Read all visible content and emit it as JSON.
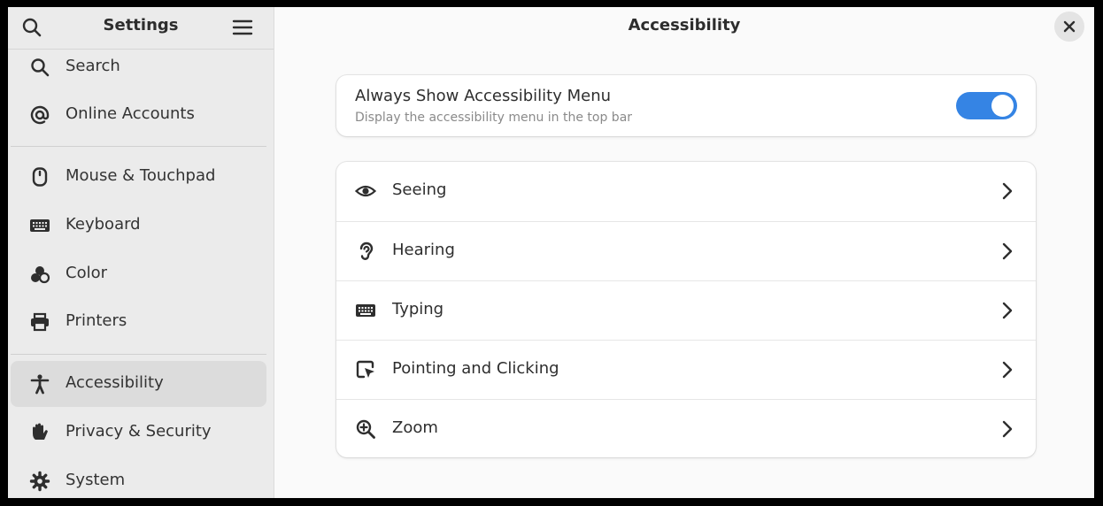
{
  "sidebar": {
    "title": "Settings",
    "items": [
      {
        "label": "Search",
        "icon": "search-icon"
      },
      {
        "label": "Online Accounts",
        "icon": "at-icon"
      },
      {
        "label": "Mouse & Touchpad",
        "icon": "mouse-icon"
      },
      {
        "label": "Keyboard",
        "icon": "keyboard-icon"
      },
      {
        "label": "Color",
        "icon": "color-icon"
      },
      {
        "label": "Printers",
        "icon": "printer-icon"
      },
      {
        "label": "Accessibility",
        "icon": "accessibility-icon",
        "active": true
      },
      {
        "label": "Privacy & Security",
        "icon": "hand-icon"
      },
      {
        "label": "System",
        "icon": "gear-icon"
      }
    ]
  },
  "main": {
    "title": "Accessibility",
    "toggle": {
      "title": "Always Show Accessibility Menu",
      "subtitle": "Display the accessibility menu in the top bar",
      "enabled": true
    },
    "rows": [
      {
        "label": "Seeing",
        "icon": "eye-icon"
      },
      {
        "label": "Hearing",
        "icon": "ear-icon"
      },
      {
        "label": "Typing",
        "icon": "keyboard-icon"
      },
      {
        "label": "Pointing and Clicking",
        "icon": "pointer-icon"
      },
      {
        "label": "Zoom",
        "icon": "zoom-in-icon"
      }
    ]
  },
  "colors": {
    "accent": "#3584e4",
    "sidebar_bg": "#ebebeb",
    "content_bg": "#fafafa",
    "active_item_bg": "#dcdcdc"
  }
}
